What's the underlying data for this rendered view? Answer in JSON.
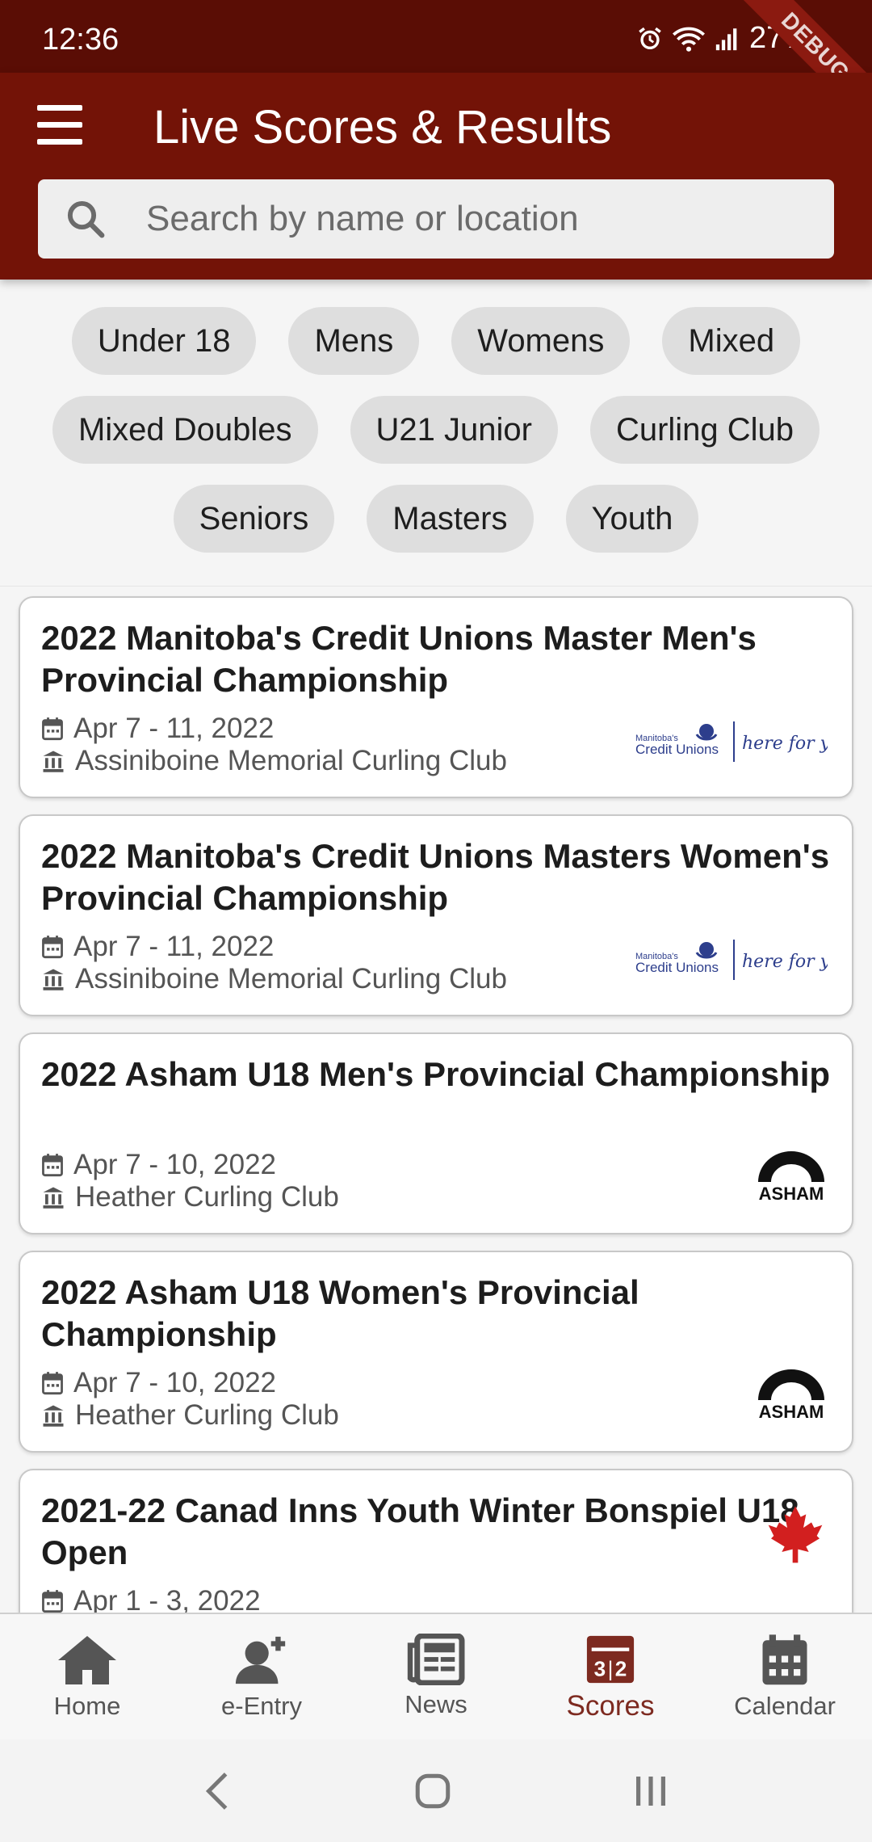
{
  "status_bar": {
    "time": "12:36",
    "battery": "27%",
    "debug_label": "DEBUG"
  },
  "app_bar": {
    "title": "Live Scores & Results"
  },
  "search": {
    "placeholder": "Search by name or location",
    "value": ""
  },
  "chips": {
    "row1": [
      "Under 18",
      "Mens",
      "Womens",
      "Mixed"
    ],
    "row2": [
      "Mixed Doubles",
      "U21 Junior",
      "Curling Club"
    ],
    "row3": [
      "Seniors",
      "Masters",
      "Youth"
    ]
  },
  "events": [
    {
      "title": "2022 Manitoba's Credit Unions Master Men's Provincial Championship",
      "date": "Apr 7 - 11, 2022",
      "venue": "Assiniboine Memorial Curling Club",
      "logo": "credit-unions-logo",
      "logo_text": [
        "Manitoba's",
        "Credit Unions",
        "here for you"
      ]
    },
    {
      "title": "2022 Manitoba's Credit Unions Masters Women's Provincial Championship",
      "date": "Apr 7 - 11, 2022",
      "venue": "Assiniboine Memorial Curling Club",
      "logo": "credit-unions-logo",
      "logo_text": [
        "Manitoba's",
        "Credit Unions",
        "here for you"
      ]
    },
    {
      "title": "2022 Asham U18 Men's Provincial Championship",
      "date": "Apr 7 - 10, 2022",
      "venue": "Heather Curling Club",
      "logo": "asham-logo",
      "logo_text": [
        "ASHAM"
      ]
    },
    {
      "title": "2022 Asham U18 Women's Provincial Championship",
      "date": "Apr 7 - 10, 2022",
      "venue": "Heather Curling Club",
      "logo": "asham-logo",
      "logo_text": [
        "ASHAM"
      ]
    },
    {
      "title": "2021-22 Canad Inns Youth Winter Bonspiel U18 Open",
      "date": "Apr 1 - 3, 2022",
      "venue": "",
      "logo": "maple-leaf-logo",
      "logo_text": []
    }
  ],
  "bottom_nav": [
    {
      "label": "Home",
      "icon": "home-icon",
      "active": false
    },
    {
      "label": "e-Entry",
      "icon": "add-user-icon",
      "active": false
    },
    {
      "label": "News",
      "icon": "newspaper-icon",
      "active": false
    },
    {
      "label": "Scores",
      "icon": "scoreboard-icon",
      "active": true
    },
    {
      "label": "Calendar",
      "icon": "calendar-icon",
      "active": false
    }
  ],
  "colors": {
    "primary": "#731307",
    "status_bar": "#5a0d05",
    "active_nav": "#7d2a20",
    "chip": "#dedede"
  }
}
